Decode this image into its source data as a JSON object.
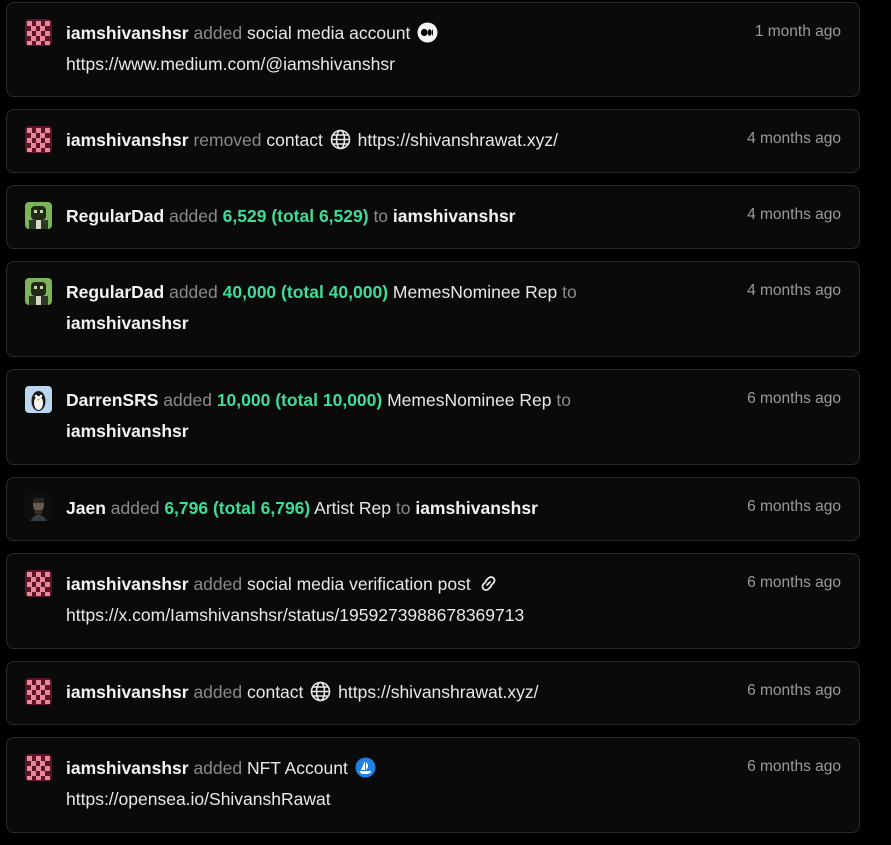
{
  "feed": [
    {
      "user": "iamshivanshsr",
      "action": "added",
      "object": "social media account",
      "icon": "medium-icon",
      "value": "https://www.medium.com/@iamshivanshsr",
      "time": "1 month ago"
    },
    {
      "user": "iamshivanshsr",
      "action": "removed",
      "object": "contact",
      "icon": "globe-icon",
      "value": "https://shivanshrawat.xyz/",
      "time": "4 months ago"
    },
    {
      "user": "RegularDad",
      "action": "added",
      "amount": "6,529",
      "total": "(total 6,529)",
      "rep": "",
      "to": "to",
      "target": "iamshivanshsr",
      "time": "4 months ago"
    },
    {
      "user": "RegularDad",
      "action": "added",
      "amount": "40,000",
      "total": "(total 40,000)",
      "rep": "MemesNominee Rep",
      "to": "to",
      "target": "iamshivanshsr",
      "time": "4 months ago"
    },
    {
      "user": "DarrenSRS",
      "action": "added",
      "amount": "10,000",
      "total": "(total 10,000)",
      "rep": "MemesNominee Rep",
      "to": "to",
      "target": "iamshivanshsr",
      "time": "6 months ago"
    },
    {
      "user": "Jaen",
      "action": "added",
      "amount": "6,796",
      "total": "(total 6,796)",
      "rep": "Artist Rep",
      "to": "to",
      "target": "iamshivanshsr",
      "time": "6 months ago"
    },
    {
      "user": "iamshivanshsr",
      "action": "added",
      "object": "social media verification post",
      "icon": "link-icon",
      "value": "https://x.com/Iamshivanshsr/status/1959273988678369713",
      "time": "6 months ago"
    },
    {
      "user": "iamshivanshsr",
      "action": "added",
      "object": "contact",
      "icon": "globe-icon",
      "value": "https://shivanshrawat.xyz/",
      "time": "6 months ago"
    },
    {
      "user": "iamshivanshsr",
      "action": "added",
      "object": "NFT Account",
      "icon": "opensea-icon",
      "value": "https://opensea.io/ShivanshRawat",
      "time": "6 months ago"
    }
  ],
  "colors": {
    "accent_green": "#3ddc97",
    "muted": "#8a8a8a",
    "opensea_blue": "#2081e2"
  }
}
